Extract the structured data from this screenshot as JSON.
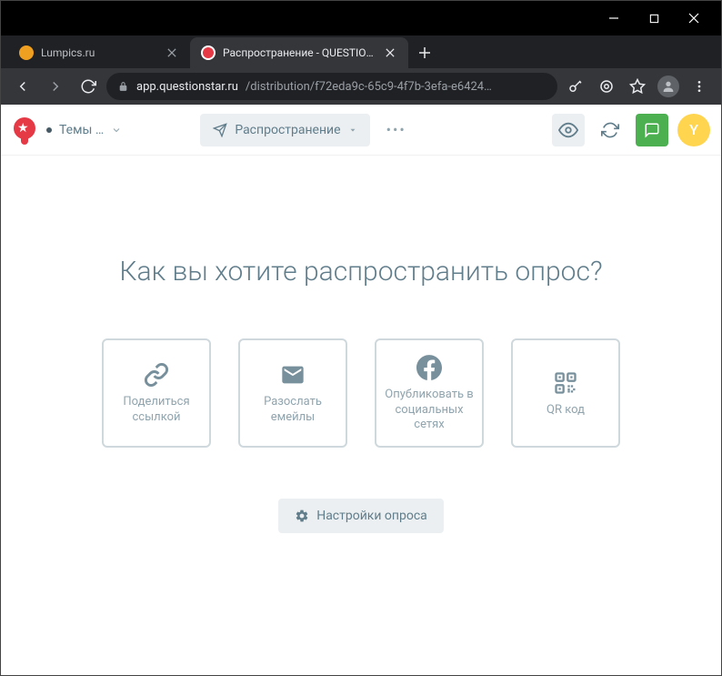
{
  "window": {
    "tabs": [
      {
        "title": "Lumpics.ru",
        "favicon_color": "#f0a020",
        "active": false
      },
      {
        "title": "Распространение - QUESTIONS",
        "favicon_color": "#e63946",
        "active": true
      }
    ]
  },
  "address": {
    "domain": "app.questionstar.ru",
    "path": "/distribution/f72eda9c-65c9-4f7b-3efa-e6424…"
  },
  "appbar": {
    "themes_label": "Темы …",
    "distribute_label": "Распространение",
    "user_initial": "Y"
  },
  "page": {
    "heading": "Как вы хотите распространить опрос?",
    "cards": [
      {
        "label": "Поделиться ссылкой",
        "icon": "link"
      },
      {
        "label": "Разослать емейлы",
        "icon": "mail"
      },
      {
        "label": "Опубликовать в социальных сетях",
        "icon": "facebook"
      },
      {
        "label": "QR код",
        "icon": "qr"
      }
    ],
    "settings_label": "Настройки опроса"
  }
}
